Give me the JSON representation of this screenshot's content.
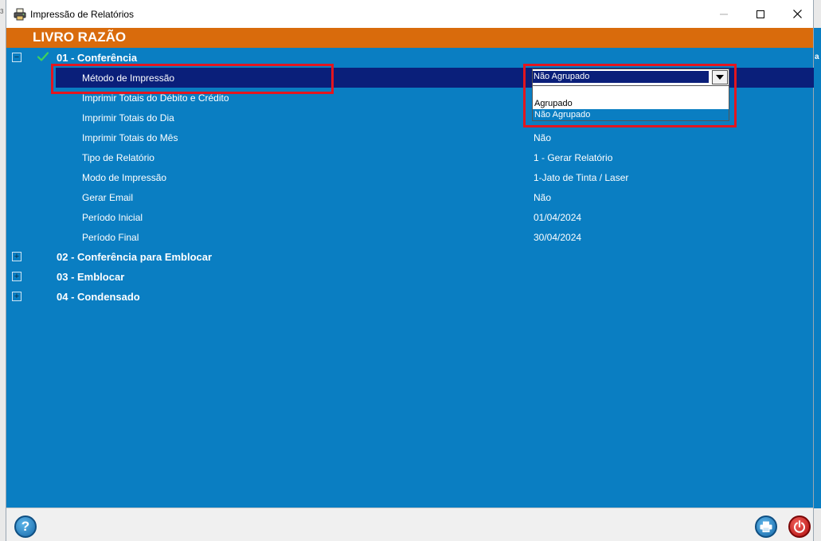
{
  "window": {
    "title": "Impressão de Relatórios"
  },
  "header": {
    "title": "LIVRO RAZÃO"
  },
  "background": {
    "left_char": "3",
    "right_char": "a"
  },
  "groups": [
    {
      "label": "01 - Conferência",
      "expander": "−"
    },
    {
      "label": "02 - Conferência para Emblocar",
      "expander": "+"
    },
    {
      "label": "03 - Emblocar",
      "expander": "+"
    },
    {
      "label": "04 - Condensado",
      "expander": "+"
    }
  ],
  "properties": [
    {
      "label": "Método de Impressão",
      "value": "Não Agrupado"
    },
    {
      "label": "Imprimir Totais do Débito e Crédito",
      "value": ""
    },
    {
      "label": "Imprimir Totais do Dia",
      "value": ""
    },
    {
      "label": "Imprimir Totais do Mês",
      "value": "Não"
    },
    {
      "label": "Tipo de Relatório",
      "value": "1 - Gerar Relatório"
    },
    {
      "label": "Modo de Impressão",
      "value": "1-Jato de Tinta / Laser"
    },
    {
      "label": "Gerar Email",
      "value": "Não"
    },
    {
      "label": "Período Inicial",
      "value": "01/04/2024"
    },
    {
      "label": "Período Final",
      "value": "30/04/2024"
    }
  ],
  "combo": {
    "selected": "Não Agrupado",
    "options": [
      "Agrupado",
      "Não Agrupado"
    ]
  },
  "buttons": {
    "help": "?"
  },
  "colors": {
    "header": "#d96b0c",
    "content": "#0a7ec2",
    "selection": "#0a1f7a",
    "highlight_box": "#e3161f"
  }
}
